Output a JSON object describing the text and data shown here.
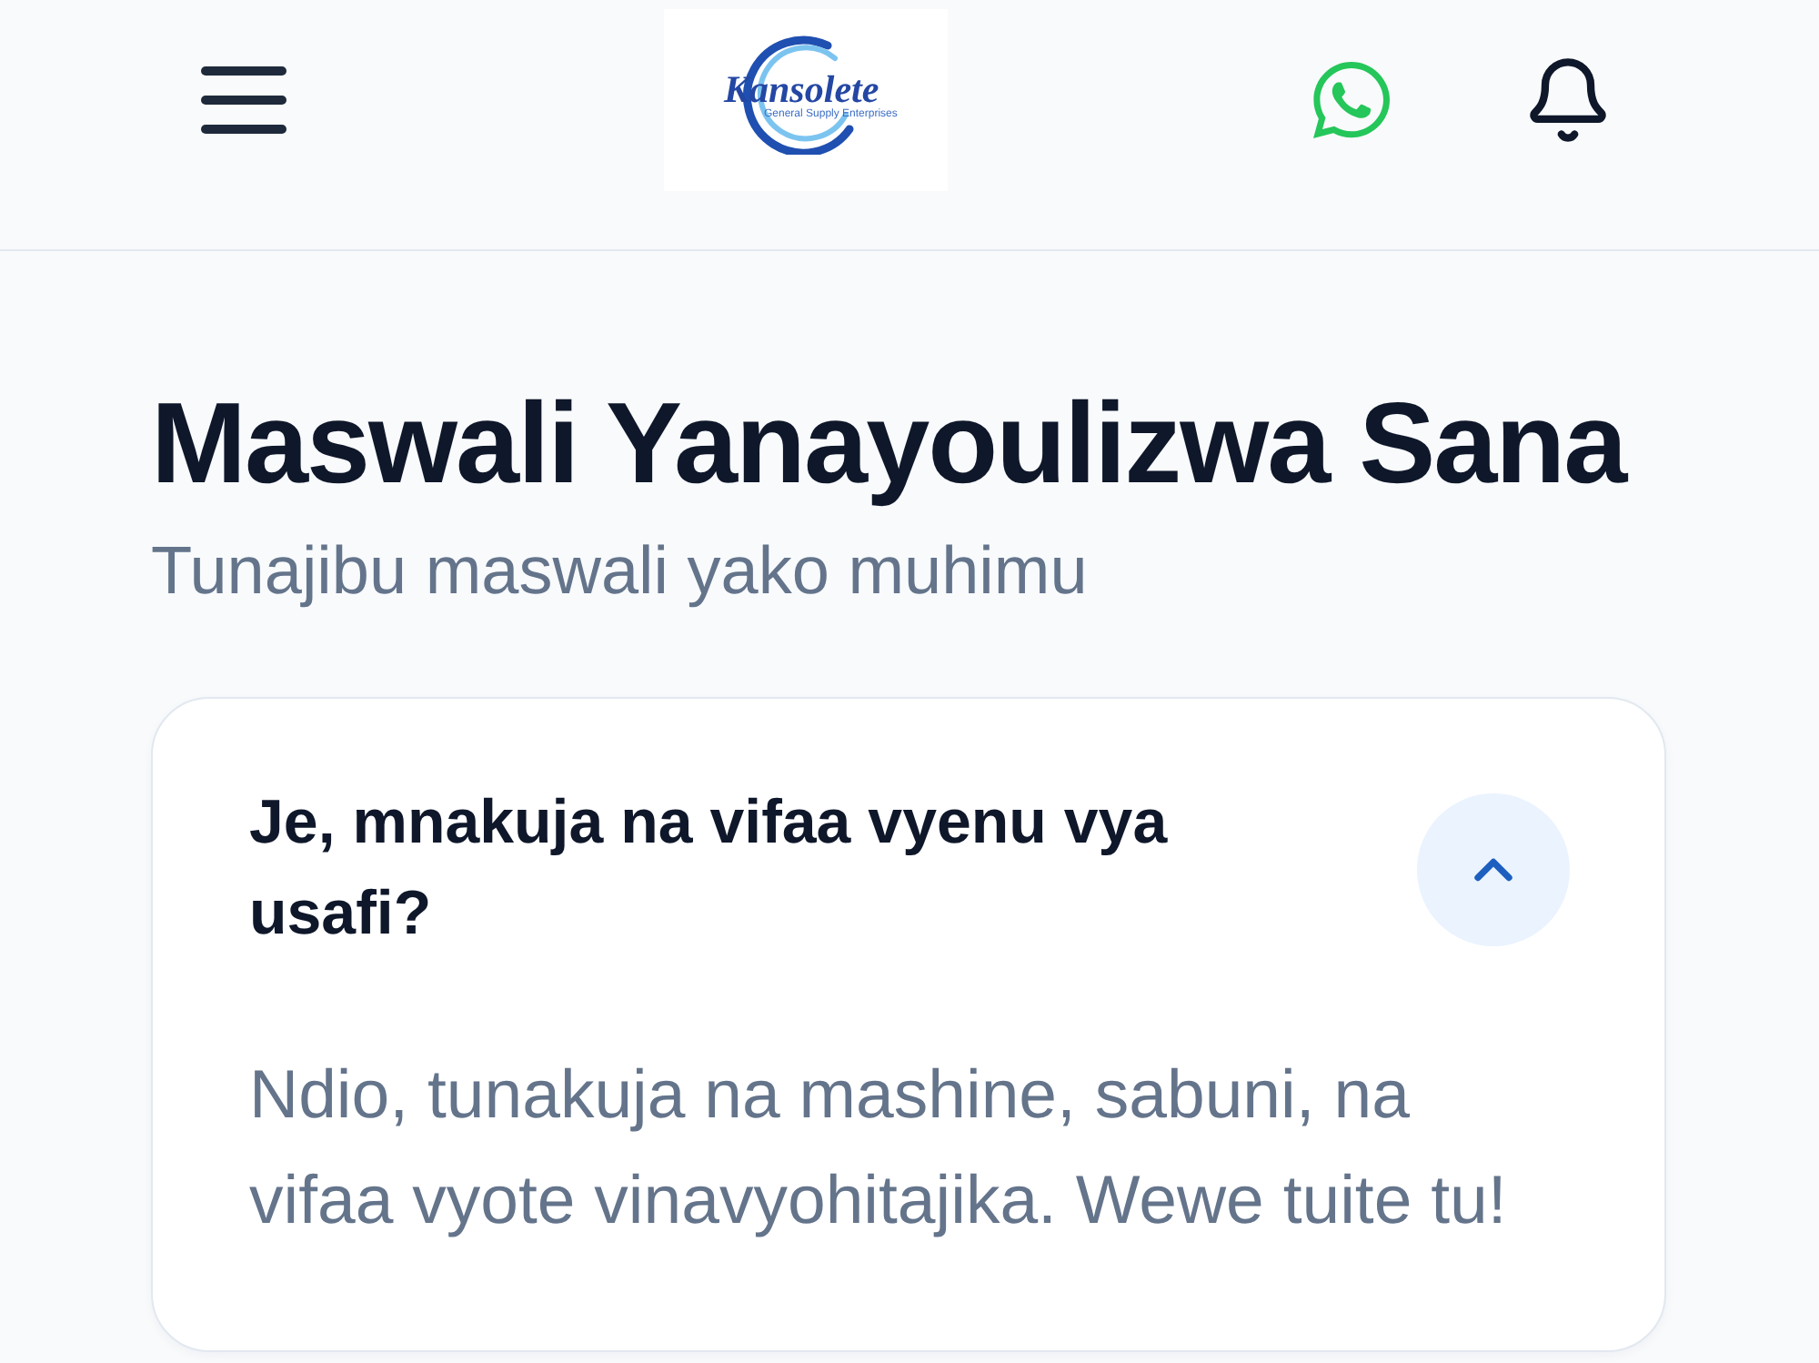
{
  "header": {
    "logo": {
      "wordmark": "Kansolete",
      "tagline": "General Supply Enterprises"
    }
  },
  "intro": {
    "title": "Maswali Yanayoulizwa Sana",
    "subtitle": "Tunajibu maswali yako muhimu"
  },
  "faqs": [
    {
      "question": "Je, mnakuja na vifaa vyenu vya usafi?",
      "answer": "Ndio, tunakuja na mashine, sabuni, na vifaa vyote vinavyohitajika. Wewe tuite tu!",
      "expanded": true
    }
  ]
}
